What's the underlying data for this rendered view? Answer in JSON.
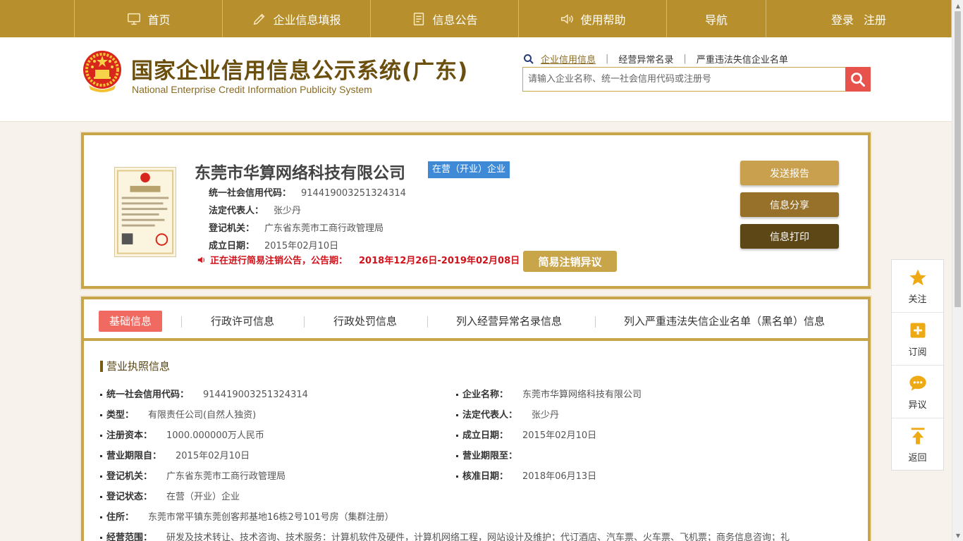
{
  "topnav": {
    "items": [
      {
        "label": "首页",
        "icon": "monitor-icon"
      },
      {
        "label": "企业信息填报",
        "icon": "pen-icon"
      },
      {
        "label": "信息公告",
        "icon": "document-icon"
      },
      {
        "label": "使用帮助",
        "icon": "speaker-icon"
      },
      {
        "label": "导航",
        "icon": ""
      },
      {
        "label": "登录",
        "icon": ""
      },
      {
        "label": "注册",
        "icon": ""
      }
    ]
  },
  "header": {
    "title_cn": "国家企业信用信息公示系统(广东)",
    "title_en": "National Enterprise Credit Information Publicity System",
    "search_tabs": [
      "企业信用信息",
      "经营异常名录",
      "严重违法失信企业名单"
    ],
    "search_placeholder": "请输入企业名称、统一社会信用代码或注册号"
  },
  "company": {
    "name": "东莞市华算网络科技有限公司",
    "status": "在营（开业）企业",
    "credit_code_label": "统一社会信用代码：",
    "credit_code": "914419003251324314",
    "legal_rep_label": "法定代表人：",
    "legal_rep": "张少丹",
    "authority_label": "登记机关：",
    "authority": "广东省东莞市工商行政管理局",
    "established_label": "成立日期：",
    "established": "2015年02月10日",
    "notice_text": "正在进行简易注销公告，公告期：",
    "notice_period": "2018年12月26日-2019年02月08日",
    "objection_label": "简易注销异议",
    "actions": [
      "发送报告",
      "信息分享",
      "信息打印"
    ],
    "action_colors": [
      "#c9a04e",
      "#97702a",
      "#5e4717"
    ]
  },
  "detail": {
    "tabs": [
      "基础信息",
      "行政许可信息",
      "行政处罚信息",
      "列入经营异常名录信息",
      "列入严重违法失信企业名单（黑名单）信息"
    ],
    "section_title": "营业执照信息",
    "fields": {
      "credit_code": {
        "label": "统一社会信用代码：",
        "value": "914419003251324314"
      },
      "company_name": {
        "label": "企业名称：",
        "value": "东莞市华算网络科技有限公司"
      },
      "type": {
        "label": "类型：",
        "value": "有限责任公司(自然人独资)"
      },
      "legal_rep": {
        "label": "法定代表人：",
        "value": "张少丹"
      },
      "capital": {
        "label": "注册资本：",
        "value": "1000.000000万人民币"
      },
      "established": {
        "label": "成立日期：",
        "value": "2015年02月10日"
      },
      "term_from": {
        "label": "营业期限自：",
        "value": "2015年02月10日"
      },
      "term_to": {
        "label": "营业期限至：",
        "value": ""
      },
      "authority": {
        "label": "登记机关：",
        "value": "广东省东莞市工商行政管理局"
      },
      "approval_date": {
        "label": "核准日期：",
        "value": "2018年06月13日"
      },
      "reg_status": {
        "label": "登记状态：",
        "value": "在营（开业）企业"
      },
      "address": {
        "label": "住所：",
        "value": "东莞市常平镇东莞创客邦基地16栋2号101号房（集群注册）"
      },
      "scope": {
        "label": "经营范围：",
        "value": "研发及技术转让、技术咨询、技术服务：计算机软件及硬件，计算机网络工程，网站设计及维护；代订酒店、汽车票、火车票、飞机票；商务信息咨询；礼"
      }
    }
  },
  "sidebar": {
    "items": [
      "关注",
      "订阅",
      "异议",
      "返回"
    ]
  },
  "colors": {
    "gold": "#b7902d",
    "border_gold": "#c9a54a",
    "accent_red": "#e8524d",
    "status_blue": "#3e8ad6"
  }
}
